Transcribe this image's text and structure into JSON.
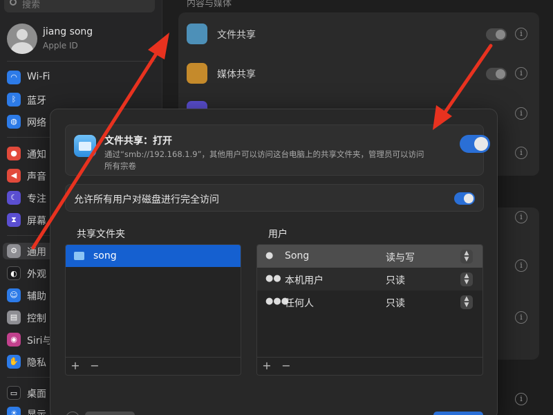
{
  "sidebar": {
    "search_placeholder": "搜索",
    "profile": {
      "name": "jiang song",
      "subtitle": "Apple ID"
    },
    "items": [
      {
        "label": "Wi-Fi",
        "icon": "wifi-icon",
        "color": "#2d7be8"
      },
      {
        "label": "蓝牙",
        "icon": "bluetooth-icon",
        "color": "#2d7be8"
      },
      {
        "label": "网络",
        "icon": "network-icon",
        "color": "#2d7be8"
      },
      {
        "label": "通知",
        "icon": "notifications-icon",
        "color": "#e24a3b"
      },
      {
        "label": "声音",
        "icon": "sound-icon",
        "color": "#e24a3b"
      },
      {
        "label": "专注",
        "icon": "focus-icon",
        "color": "#5b4fd1"
      },
      {
        "label": "屏幕",
        "icon": "screen-time-icon",
        "color": "#5b4fd1"
      },
      {
        "label": "通用",
        "icon": "gear-icon",
        "color": "#8e8e93"
      },
      {
        "label": "外观",
        "icon": "appearance-icon",
        "color": "#1c1c1e"
      },
      {
        "label": "辅助",
        "icon": "accessibility-icon",
        "color": "#2d7be8"
      },
      {
        "label": "控制",
        "icon": "control-center-icon",
        "color": "#8e8e93"
      },
      {
        "label": "Siri与",
        "icon": "siri-icon",
        "color": "#c2418d"
      },
      {
        "label": "隐私",
        "icon": "privacy-hand-icon",
        "color": "#2d7be8"
      },
      {
        "label": "桌面",
        "icon": "desktop-icon",
        "color": "#1c1c1e"
      },
      {
        "label": "显示",
        "icon": "display-icon",
        "color": "#2d7be8"
      }
    ]
  },
  "main": {
    "section_title": "内容与媒体",
    "rows": [
      {
        "label": "文件共享",
        "icon": "file-sharing-icon",
        "color": "#4d90b8"
      },
      {
        "label": "媒体共享",
        "icon": "media-sharing-icon",
        "color": "#c58a2b"
      }
    ]
  },
  "sheet": {
    "title": "文件共享：打开",
    "description": "通过“smb://192.168.1.9”，其他用户可以访问这台电脑上的共享文件夹，管理员可以访问所有宗卷",
    "allow_all_label": "允许所有用户对磁盘进行完全访问",
    "folders_header": "共享文件夹",
    "users_header": "用户",
    "folders": [
      {
        "name": "song"
      }
    ],
    "users": [
      {
        "name": "Song",
        "permission": "读与写",
        "icon": "person-icon"
      },
      {
        "name": "本机用户",
        "permission": "只读",
        "icon": "group-icon"
      },
      {
        "name": "任何人",
        "permission": "只读",
        "icon": "everyone-icon"
      }
    ],
    "add_symbol": "+",
    "remove_symbol": "−",
    "info_symbol": "i"
  },
  "colors": {
    "accent": "#2a6fd6",
    "annotation": "#e8321f"
  }
}
